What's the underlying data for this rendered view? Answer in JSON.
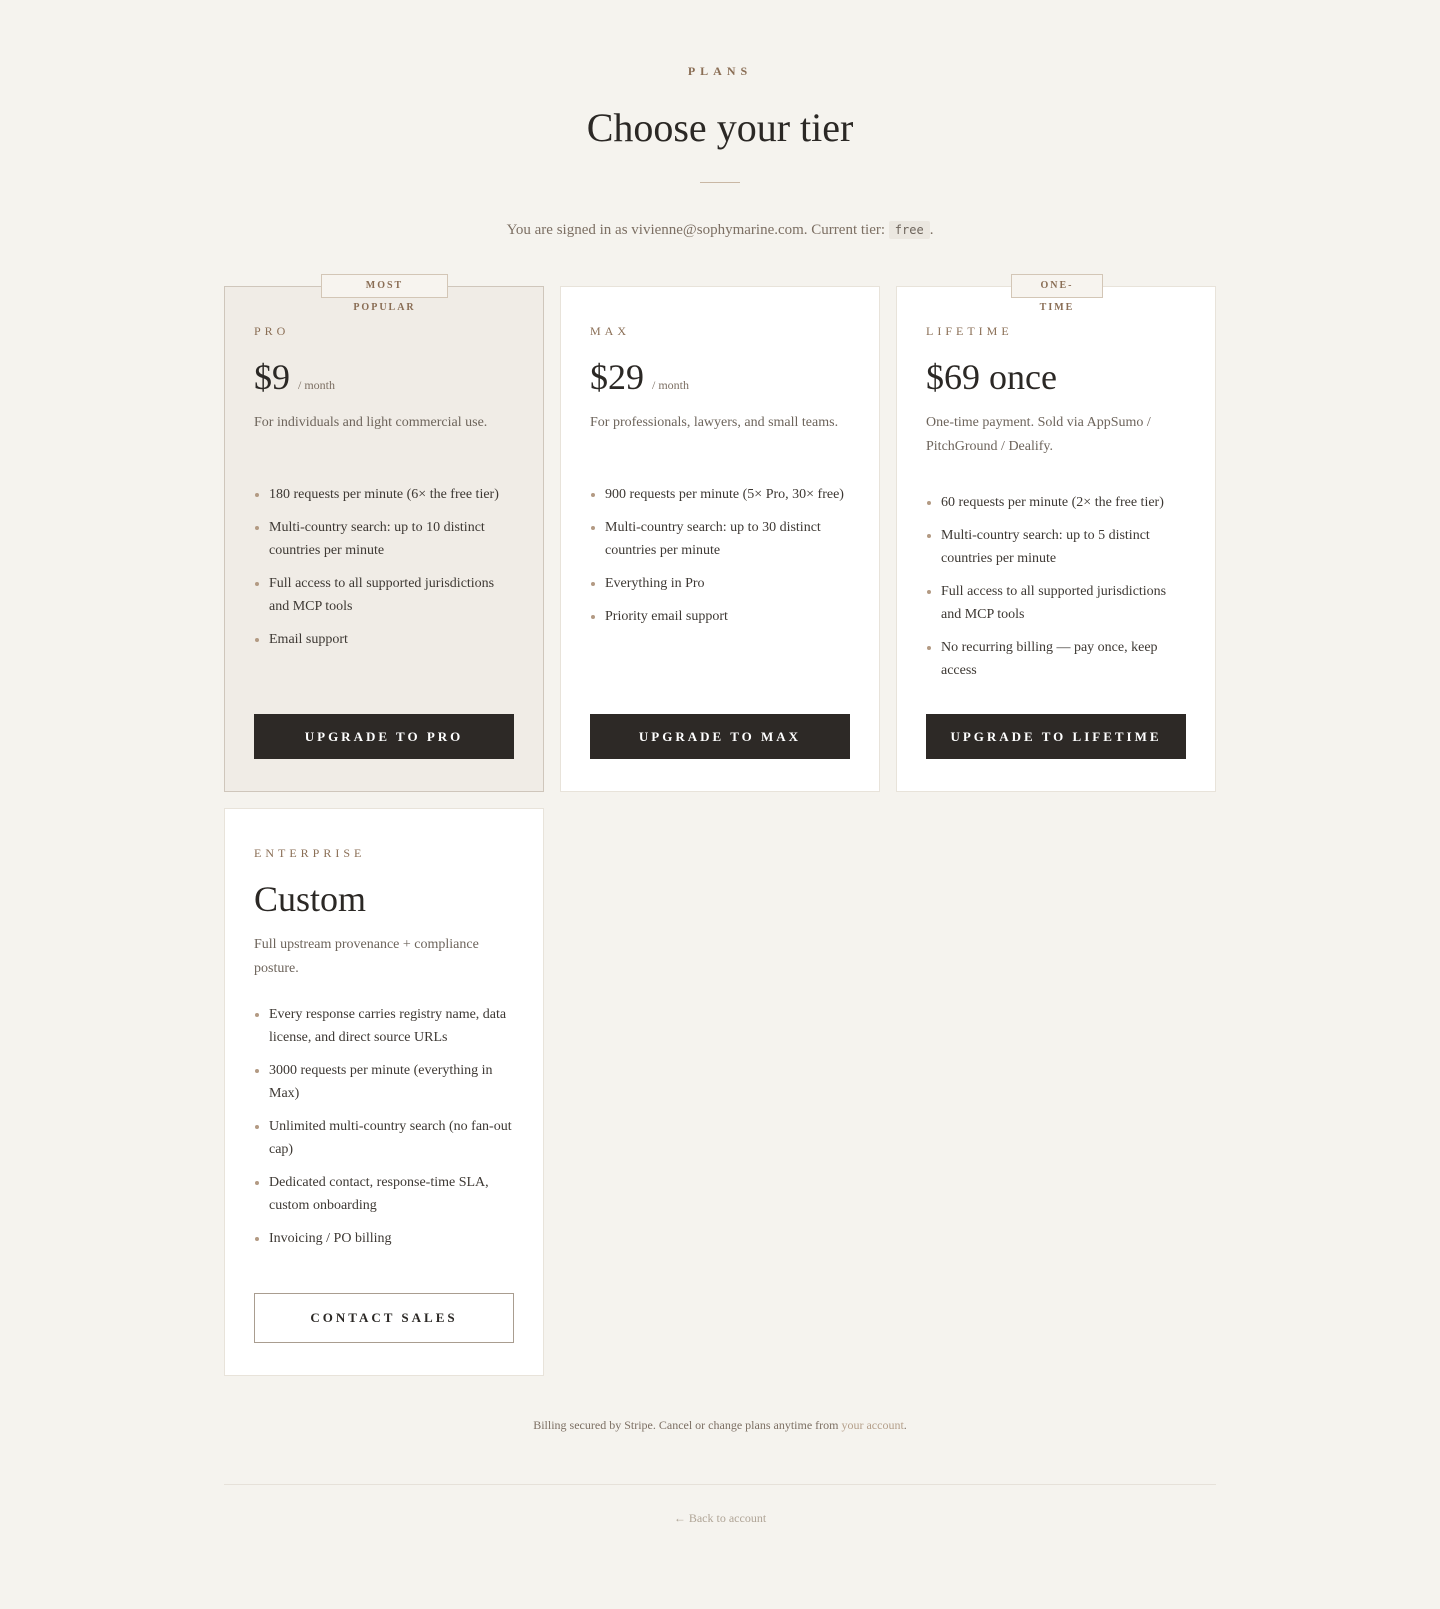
{
  "header": {
    "eyebrow": "PLANS",
    "title": "Choose your tier",
    "signed_prefix": "You are signed in as vivienne@sophymarine.com. Current tier:",
    "current_tier": "free",
    "signed_suffix": "."
  },
  "plans": [
    {
      "badge": "MOST POPULAR",
      "name": "PRO",
      "price": "$9",
      "period": "/ month",
      "description": "For individuals and light commercial use.",
      "features": [
        "180 requests per minute (6× the free tier)",
        "Multi-country search: up to 10 distinct countries per minute",
        "Full access to all supported jurisdictions and MCP tools",
        "Email support"
      ],
      "cta": "UPGRADE TO PRO"
    },
    {
      "name": "MAX",
      "price": "$29",
      "period": "/ month",
      "description": "For professionals, lawyers, and small teams.",
      "features": [
        "900 requests per minute (5× Pro, 30× free)",
        "Multi-country search: up to 30 distinct countries per minute",
        "Everything in Pro",
        "Priority email support"
      ],
      "cta": "UPGRADE TO MAX"
    },
    {
      "badge": "ONE-TIME",
      "name": "LIFETIME",
      "price": "$69 once",
      "description": "One-time payment. Sold via AppSumo / PitchGround / Dealify.",
      "features": [
        "60 requests per minute (2× the free tier)",
        "Multi-country search: up to 5 distinct countries per minute",
        "Full access to all supported jurisdictions and MCP tools",
        "No recurring billing — pay once, keep access"
      ],
      "cta": "UPGRADE TO LIFETIME"
    },
    {
      "name": "ENTERPRISE",
      "price": "Custom",
      "description": "Full upstream provenance + compliance posture.",
      "features": [
        "Every response carries registry name, data license, and direct source URLs",
        "3000 requests per minute (everything in Max)",
        "Unlimited multi-country search (no fan-out cap)",
        "Dedicated contact, response-time SLA, custom onboarding",
        "Invoicing / PO billing"
      ],
      "cta": "CONTACT SALES"
    }
  ],
  "footer": {
    "note_prefix": "Billing secured by Stripe. Cancel or change plans anytime from",
    "note_link": "your account",
    "note_suffix": ".",
    "back_link": "← Back to account"
  }
}
